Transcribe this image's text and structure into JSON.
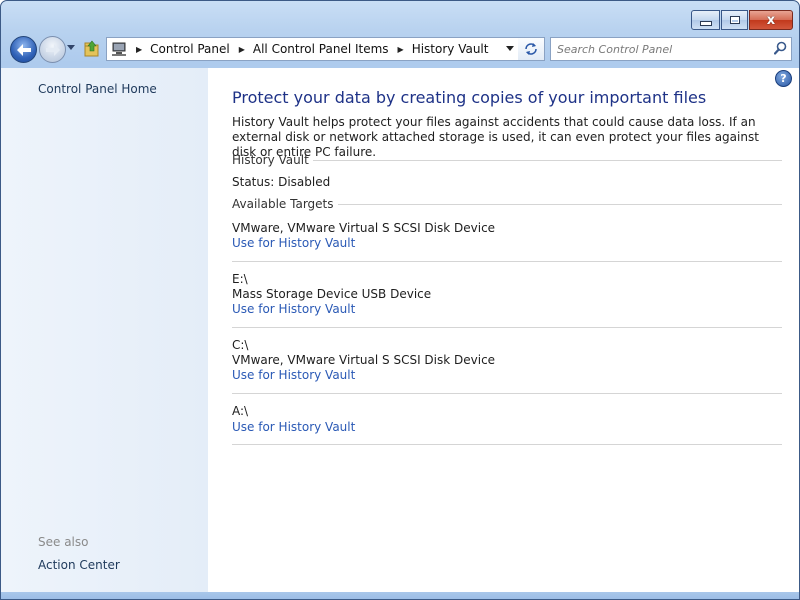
{
  "window": {
    "minimize_label": "",
    "close_glyph": "x",
    "colors": {
      "frame": "#b8d2ef",
      "link": "#2a59b5",
      "heading": "#1e3287"
    }
  },
  "nav": {
    "breadcrumbs": [
      "Control Panel",
      "All Control Panel Items",
      "History Vault"
    ],
    "search_placeholder": "Search Control Panel",
    "icons": [
      "back-arrow-icon",
      "forward-arrow-icon",
      "recent-pages-icon",
      "up-folder-icon",
      "computer-icon",
      "refresh-icon",
      "search-icon"
    ]
  },
  "sidebar": {
    "home": "Control Panel Home",
    "see_also": "See also",
    "action_center": "Action Center"
  },
  "main": {
    "heading": "Protect your data by creating copies of your important files",
    "description": "History Vault helps protect your files against accidents that could cause data loss. If an external disk or network attached storage is used, it can even protect your files against disk or entire PC failure.",
    "section_vault": "History Vault",
    "status": "Status: Disabled",
    "section_targets": "Available Targets",
    "targets": [
      {
        "drive": "",
        "device": "VMware, VMware Virtual S SCSI Disk Device",
        "link": "Use for History Vault"
      },
      {
        "drive": "E:\\",
        "device": "Mass Storage Device USB Device",
        "link": "Use for History Vault"
      },
      {
        "drive": "C:\\",
        "device": "VMware, VMware Virtual S SCSI Disk Device",
        "link": "Use for History Vault"
      },
      {
        "drive": "A:\\",
        "device": "",
        "link": "Use for History Vault"
      }
    ]
  }
}
